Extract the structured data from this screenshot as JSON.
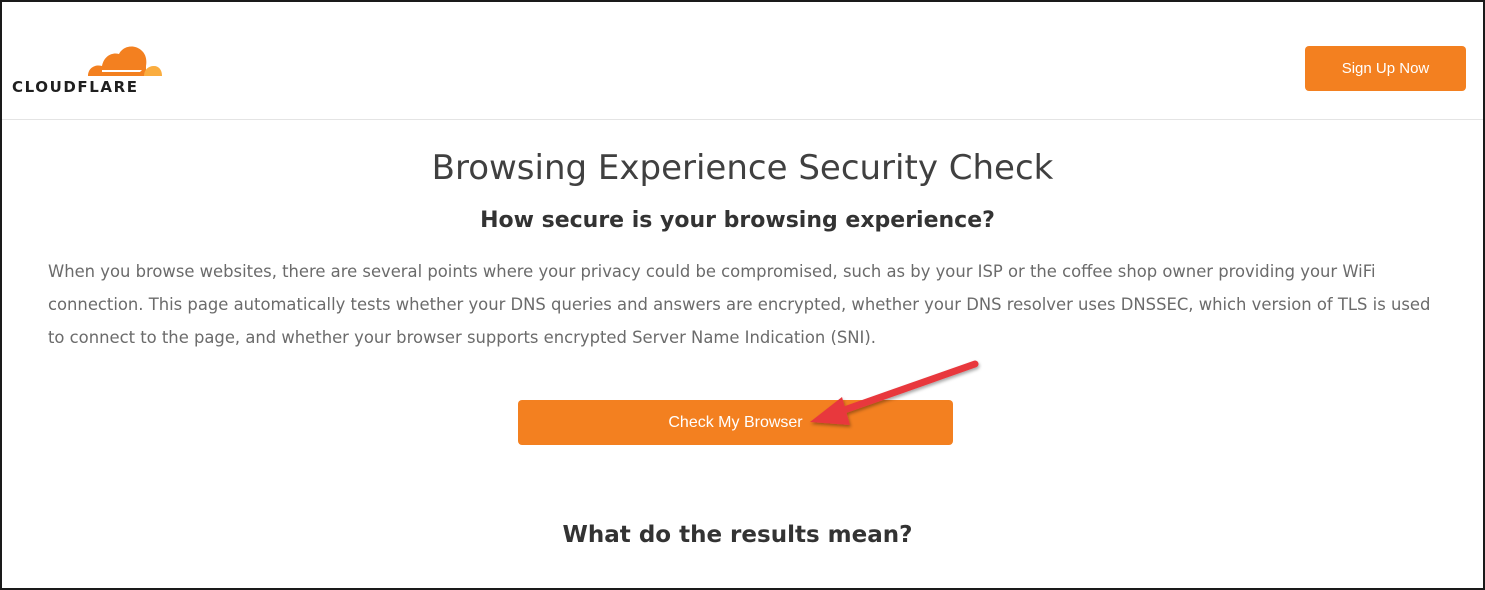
{
  "header": {
    "logo_text": "CLOUDFLARE",
    "signup_label": "Sign Up Now"
  },
  "main": {
    "title": "Browsing Experience Security Check",
    "subtitle": "How secure is your browsing experience?",
    "description": "When you browse websites, there are several points where your privacy could be compromised, such as by your ISP or the coffee shop owner providing your WiFi connection. This page automatically tests whether your DNS queries and answers are encrypted, whether your DNS resolver uses DNSSEC, which version of TLS is used to connect to the page, and whether your browser supports encrypted Server Name Indication (SNI).",
    "check_button_label": "Check My Browser",
    "results_heading": "What do the results mean?"
  },
  "colors": {
    "brand_orange": "#f38020",
    "annotation_arrow": "#e8383d"
  }
}
